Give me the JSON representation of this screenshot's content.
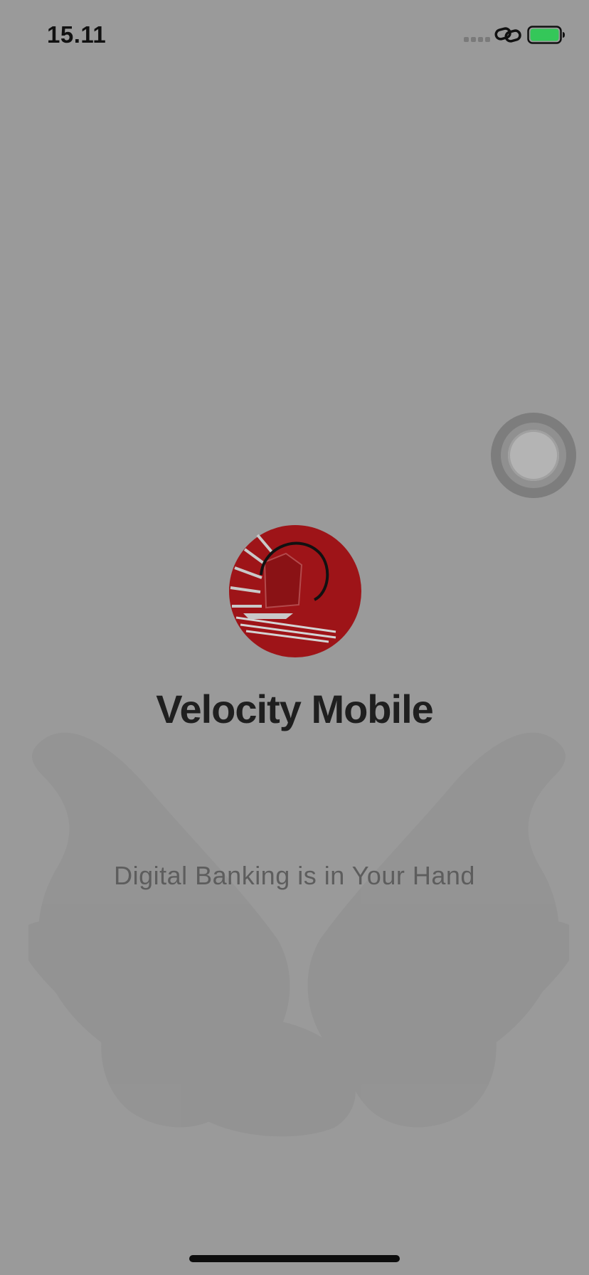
{
  "status_bar": {
    "time": "15.11",
    "signal_icon": "signal-dots-icon",
    "link_icon": "link-icon",
    "battery_icon": "battery-icon",
    "battery_color": "#34c759"
  },
  "splash": {
    "logo_icon": "junk-ship-logo-icon",
    "brand_color": "#9e1418",
    "app_title": "Velocity Mobile",
    "tagline": "Digital Banking is in Your Hand",
    "background_image": "open-hands-image"
  },
  "overlay": {
    "assistive_touch_icon": "assistive-touch-icon"
  }
}
